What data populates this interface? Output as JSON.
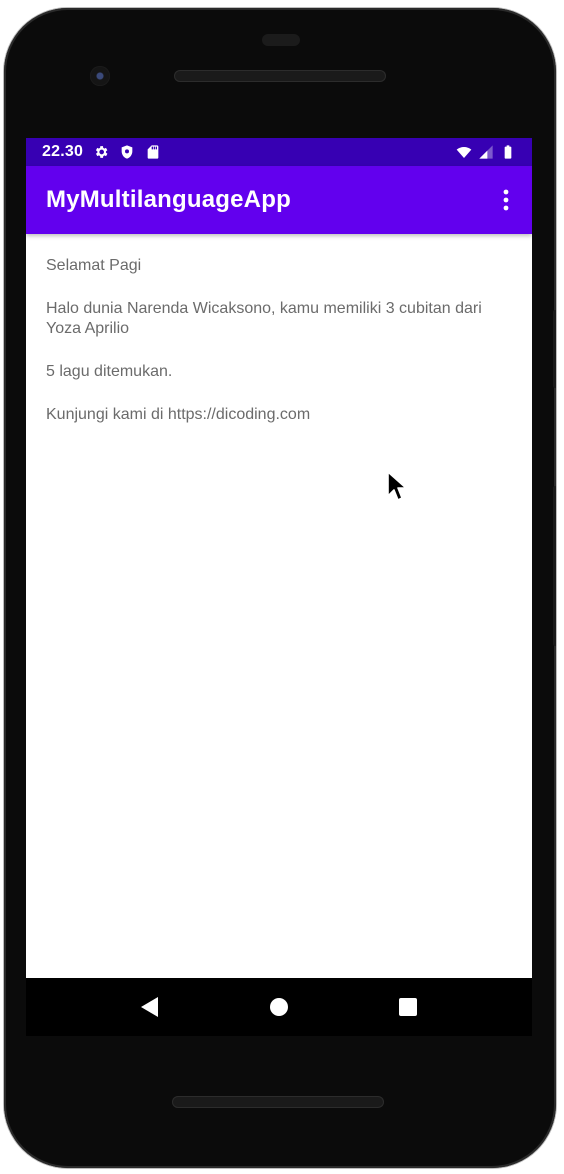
{
  "status_bar": {
    "time": "22.30",
    "icons_left": [
      "gear-icon",
      "shield-icon",
      "sd-card-icon"
    ],
    "icons_right": [
      "wifi-icon",
      "signal-icon",
      "battery-icon"
    ]
  },
  "app_bar": {
    "title": "MyMultilanguageApp",
    "background": "#6200ee",
    "status_background": "#3700b3",
    "menu_icon": "overflow-menu-icon"
  },
  "content": {
    "lines": [
      "Selamat Pagi",
      "Halo dunia Narenda Wicaksono, kamu memiliki 3 cubitan dari Yoza Aprilio",
      "5 lagu ditemukan.",
      "Kunjungi kami di https://dicoding.com"
    ],
    "text_color": "#6b6b6b"
  },
  "nav_bar": {
    "buttons": [
      "back-icon",
      "home-icon",
      "recents-icon"
    ]
  }
}
